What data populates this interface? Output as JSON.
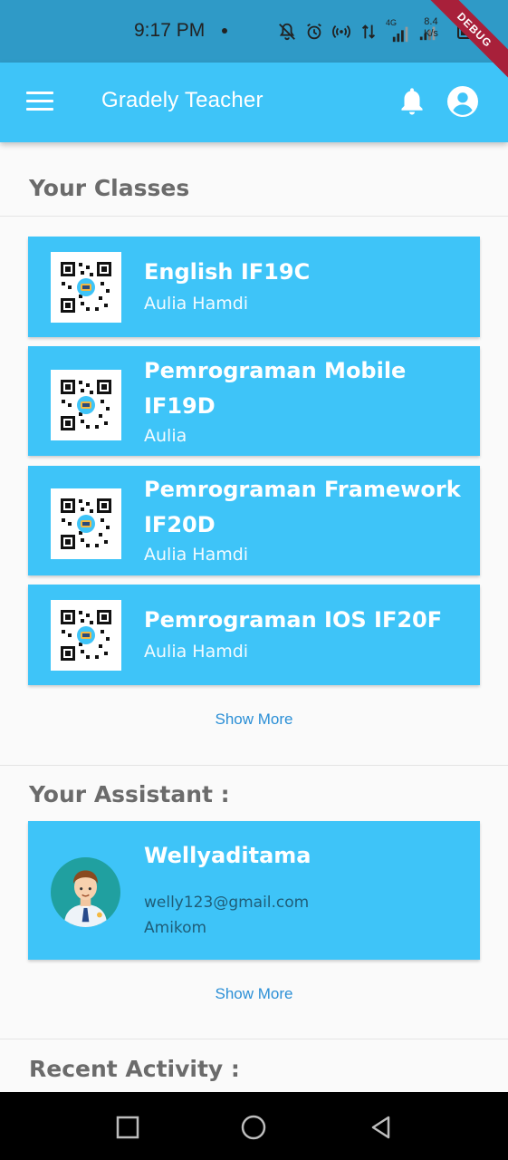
{
  "status_bar": {
    "time": "9:17 PM",
    "net_speed_value": "8.4",
    "net_speed_unit": "K/s",
    "network_type": "4G",
    "icons": [
      "dnd-off-icon",
      "alarm-icon",
      "hotspot-icon",
      "data-arrows-icon",
      "signal-icon",
      "signal-icon-2",
      "battery-icon"
    ]
  },
  "debug_banner": "DEBUG",
  "app_bar": {
    "title": "Gradely Teacher",
    "icons": [
      "menu-icon",
      "bell-icon",
      "account-icon"
    ]
  },
  "classes_section": {
    "title": "Your Classes",
    "items": [
      {
        "name": "English IF19C",
        "teacher": "Aulia Hamdi"
      },
      {
        "name": "Pemrograman Mobile IF19D",
        "teacher": "Aulia"
      },
      {
        "name": "Pemrograman Framework IF20D",
        "teacher": "Aulia Hamdi"
      },
      {
        "name": "Pemrograman IOS IF20F",
        "teacher": "Aulia Hamdi"
      }
    ],
    "show_more": "Show More"
  },
  "assistant_section": {
    "title": "Your Assistant :",
    "assistant": {
      "name": "Wellyaditama",
      "email": "welly123@gmail.com",
      "organization": "Amikom"
    },
    "show_more": "Show More"
  },
  "activity_section": {
    "title": "Recent Activity :"
  },
  "nav_bar": {
    "buttons": [
      "recents-square-icon",
      "home-circle-icon",
      "back-triangle-icon"
    ]
  },
  "colors": {
    "status_bar": "#2f9ac7",
    "app_bar": "#3ec4f8",
    "card": "#3ec4f8",
    "link": "#2b8fd6",
    "section_title": "#6b6b6b"
  }
}
